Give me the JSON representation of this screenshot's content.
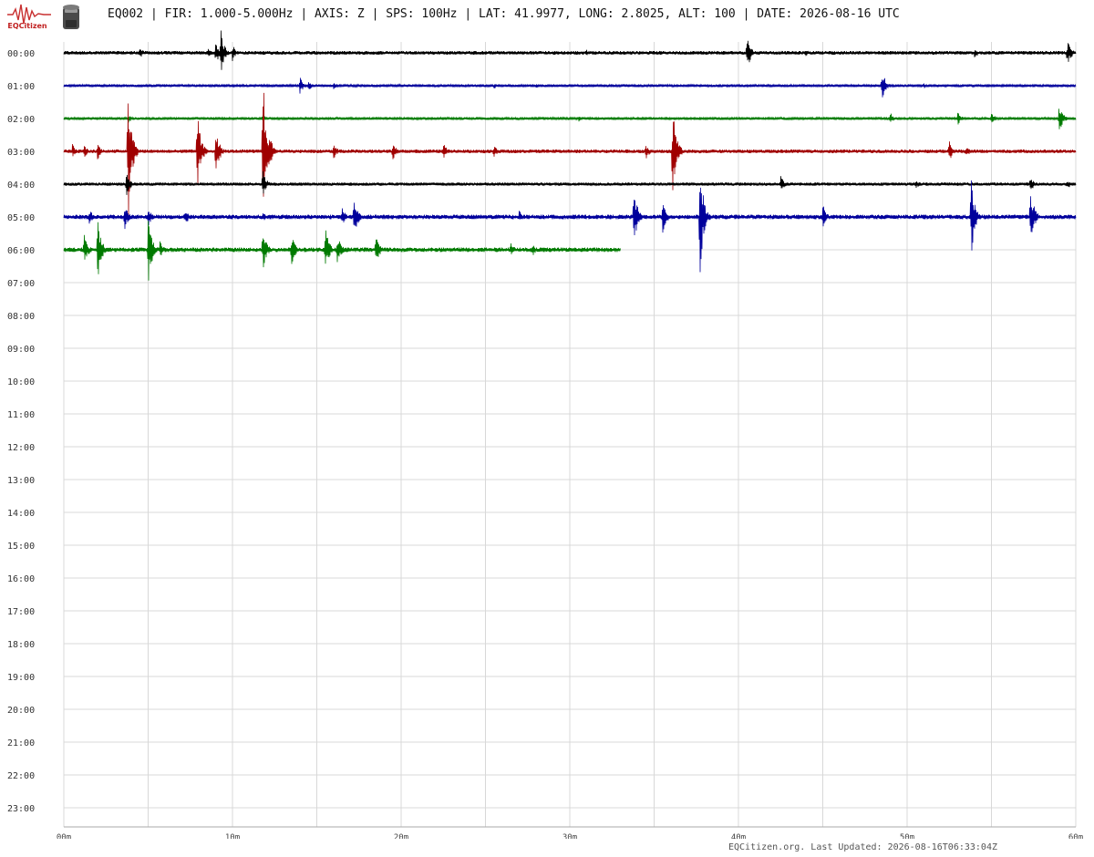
{
  "logo": {
    "text": "EQCitizen"
  },
  "header": {
    "title": "EQ002 | FIR: 1.000-5.000Hz | AXIS: Z | SPS: 100Hz | LAT: 41.9977, LONG: 2.8025, ALT: 100 | DATE: 2026-08-16 UTC"
  },
  "footer": {
    "text": "EQCitizen.org. Last Updated: 2026-08-16T06:33:04Z"
  },
  "chart_data": {
    "type": "line",
    "y_tick_labels": [
      "00:00",
      "01:00",
      "02:00",
      "03:00",
      "04:00",
      "05:00",
      "06:00",
      "07:00",
      "08:00",
      "09:00",
      "10:00",
      "11:00",
      "12:00",
      "13:00",
      "14:00",
      "15:00",
      "16:00",
      "17:00",
      "18:00",
      "19:00",
      "20:00",
      "21:00",
      "22:00",
      "23:00"
    ],
    "x_tick_labels": [
      "00m",
      "10m",
      "20m",
      "30m",
      "40m",
      "50m",
      "60m"
    ],
    "xlim": [
      0,
      60
    ],
    "grid": true,
    "trace_colors": [
      "#000000",
      "#00009c",
      "#007a00",
      "#a00000"
    ],
    "rows": [
      {
        "hour": "00:00",
        "end_min": 60,
        "noise": 2,
        "events": [
          [
            4.5,
            7
          ],
          [
            8.5,
            6
          ],
          [
            9,
            14
          ],
          [
            9.3,
            28
          ],
          [
            10,
            10
          ],
          [
            31,
            4
          ],
          [
            40.5,
            22
          ],
          [
            44,
            5
          ],
          [
            54,
            7
          ],
          [
            59.5,
            16
          ]
        ]
      },
      {
        "hour": "01:00",
        "end_min": 60,
        "noise": 1.5,
        "events": [
          [
            14,
            10
          ],
          [
            14.5,
            6
          ],
          [
            16,
            5
          ],
          [
            25.5,
            4
          ],
          [
            28,
            3
          ],
          [
            48.5,
            20
          ],
          [
            51,
            3
          ]
        ]
      },
      {
        "hour": "02:00",
        "end_min": 60,
        "noise": 1.5,
        "events": [
          [
            3.8,
            6
          ],
          [
            7.9,
            3
          ],
          [
            11.8,
            5
          ],
          [
            30.5,
            4
          ],
          [
            49,
            7
          ],
          [
            53,
            8
          ],
          [
            55,
            7
          ],
          [
            59,
            20
          ]
        ]
      },
      {
        "hour": "03:00",
        "end_min": 60,
        "noise": 2,
        "events": [
          [
            0.5,
            9
          ],
          [
            1.2,
            8
          ],
          [
            2,
            10
          ],
          [
            3.8,
            88
          ],
          [
            7.9,
            50
          ],
          [
            9,
            30
          ],
          [
            11.8,
            90
          ],
          [
            12.2,
            20
          ],
          [
            16,
            10
          ],
          [
            19.5,
            12
          ],
          [
            22.5,
            10
          ],
          [
            25.5,
            8
          ],
          [
            34.5,
            10
          ],
          [
            36.1,
            56
          ],
          [
            52.5,
            12
          ],
          [
            53.5,
            8
          ]
        ]
      },
      {
        "hour": "04:00",
        "end_min": 60,
        "noise": 1.8,
        "events": [
          [
            3.7,
            16
          ],
          [
            11.8,
            16
          ],
          [
            42.5,
            10
          ],
          [
            50.5,
            6
          ],
          [
            57.3,
            10
          ],
          [
            59.5,
            6
          ]
        ]
      },
      {
        "hour": "05:00",
        "end_min": 60,
        "noise": 2.5,
        "events": [
          [
            1.5,
            11
          ],
          [
            3.6,
            16
          ],
          [
            5,
            11
          ],
          [
            7.2,
            10
          ],
          [
            11.8,
            6
          ],
          [
            16.5,
            12
          ],
          [
            17.2,
            24
          ],
          [
            27,
            8
          ],
          [
            33.8,
            35
          ],
          [
            35.5,
            20
          ],
          [
            37.7,
            72
          ],
          [
            45,
            15
          ],
          [
            53.8,
            45
          ],
          [
            57.3,
            40
          ]
        ]
      },
      {
        "hour": "06:00",
        "end_min": 33,
        "noise": 2.5,
        "events": [
          [
            1.2,
            20
          ],
          [
            2,
            38
          ],
          [
            5,
            44
          ],
          [
            5.7,
            10
          ],
          [
            11.8,
            25
          ],
          [
            13.5,
            20
          ],
          [
            15.5,
            28
          ],
          [
            16.2,
            20
          ],
          [
            18.5,
            18
          ],
          [
            26.5,
            10
          ],
          [
            27.8,
            8
          ]
        ]
      }
    ]
  }
}
